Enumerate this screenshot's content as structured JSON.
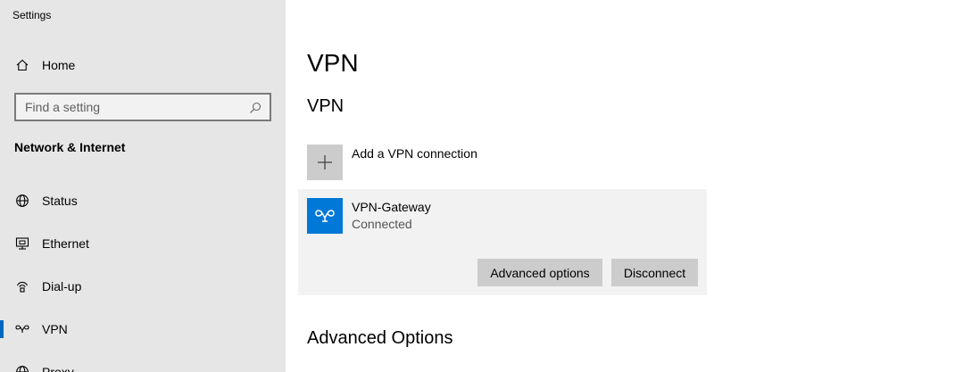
{
  "window": {
    "title": "Settings"
  },
  "sidebar": {
    "home_label": "Home",
    "search": {
      "placeholder": "Find a setting"
    },
    "section_heading": "Network & Internet",
    "items": [
      {
        "label": "Status",
        "icon": "globe-icon"
      },
      {
        "label": "Ethernet",
        "icon": "ethernet-icon"
      },
      {
        "label": "Dial-up",
        "icon": "dialup-icon"
      },
      {
        "label": "VPN",
        "icon": "vpn-icon",
        "selected": true
      },
      {
        "label": "Proxy",
        "icon": "globe-icon"
      }
    ]
  },
  "main": {
    "page_title": "VPN",
    "section_title": "VPN",
    "add_connection_label": "Add a VPN connection",
    "connection": {
      "name": "VPN-Gateway",
      "status": "Connected",
      "advanced_button": "Advanced options",
      "disconnect_button": "Disconnect"
    },
    "advanced_heading": "Advanced Options"
  },
  "colors": {
    "sidebar_bg": "#e6e6e6",
    "accent": "#0067c0",
    "vpn_tile": "#0078d7",
    "button_bg": "#cccccc",
    "card_bg": "#f2f2f2"
  }
}
